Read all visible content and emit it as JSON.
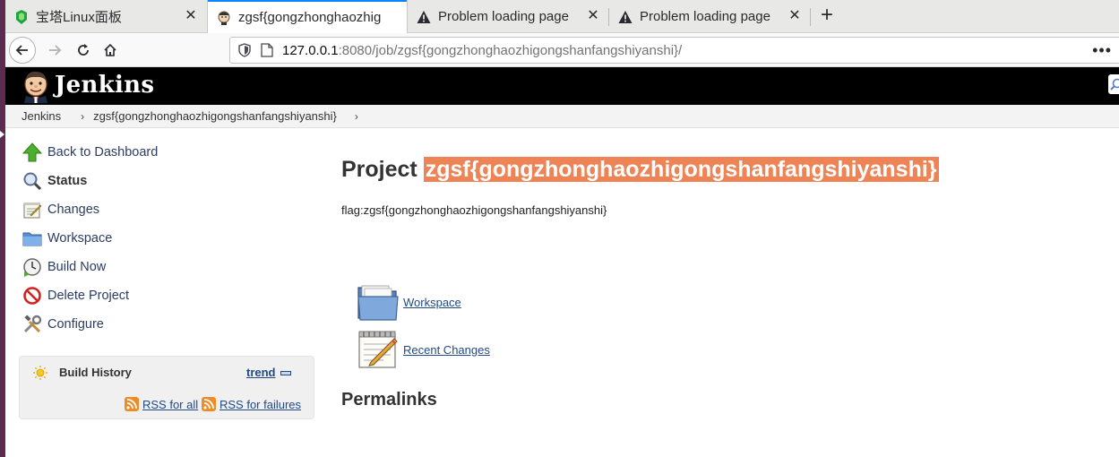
{
  "browser": {
    "tabs": [
      {
        "label": "宝塔Linux面板",
        "icon": "bt-panel-icon",
        "active": false
      },
      {
        "label": "zgsf{gongzhonghaozhig",
        "icon": "jenkins-favicon-icon",
        "active": true
      },
      {
        "label": "Problem loading page",
        "icon": "warning-icon",
        "active": false
      },
      {
        "label": "Problem loading page",
        "icon": "warning-icon",
        "active": false
      }
    ],
    "new_tab_symbol": "+",
    "close_symbol": "✕",
    "url_host": "127.0.0.1",
    "url_rest": ":8080/job/zgsf{gongzhonghaozhigongshanfangshiyanshi}/",
    "more_symbol": "•••"
  },
  "header": {
    "title": "Jenkins"
  },
  "breadcrumb": {
    "items": [
      "Jenkins",
      "zgsf{gongzhonghaozhigongshanfangshiyanshi}"
    ],
    "arrow": "›"
  },
  "sidepanel": {
    "tasks": [
      {
        "label": "Back to Dashboard",
        "icon": "up-arrow-icon"
      },
      {
        "label": "Status",
        "icon": "search-icon"
      },
      {
        "label": "Changes",
        "icon": "notepad-icon"
      },
      {
        "label": "Workspace",
        "icon": "folder-icon"
      },
      {
        "label": "Build Now",
        "icon": "clock-icon"
      },
      {
        "label": "Delete Project",
        "icon": "no-entry-icon"
      },
      {
        "label": "Configure",
        "icon": "tools-icon"
      }
    ],
    "build_history": {
      "title": "Build History",
      "trend": "trend",
      "rss_all": "RSS for all",
      "rss_failures": "RSS for failures"
    }
  },
  "main": {
    "title_prefix": "Project",
    "title_name": "zgsf{gongzhonghaozhigongshanfangshiyanshi}",
    "description": "flag:zgsf{gongzhonghaozhigongshanfangshiyanshi}",
    "links": [
      {
        "label": "Workspace",
        "icon": "folder-icon"
      },
      {
        "label": "Recent Changes",
        "icon": "notepad-icon"
      }
    ],
    "permalinks_heading": "Permalinks"
  },
  "colors": {
    "header_bg": "#000000",
    "title_highlight": "#ee8456",
    "link": "#204a87",
    "tab_accent": "#0a84ff"
  }
}
